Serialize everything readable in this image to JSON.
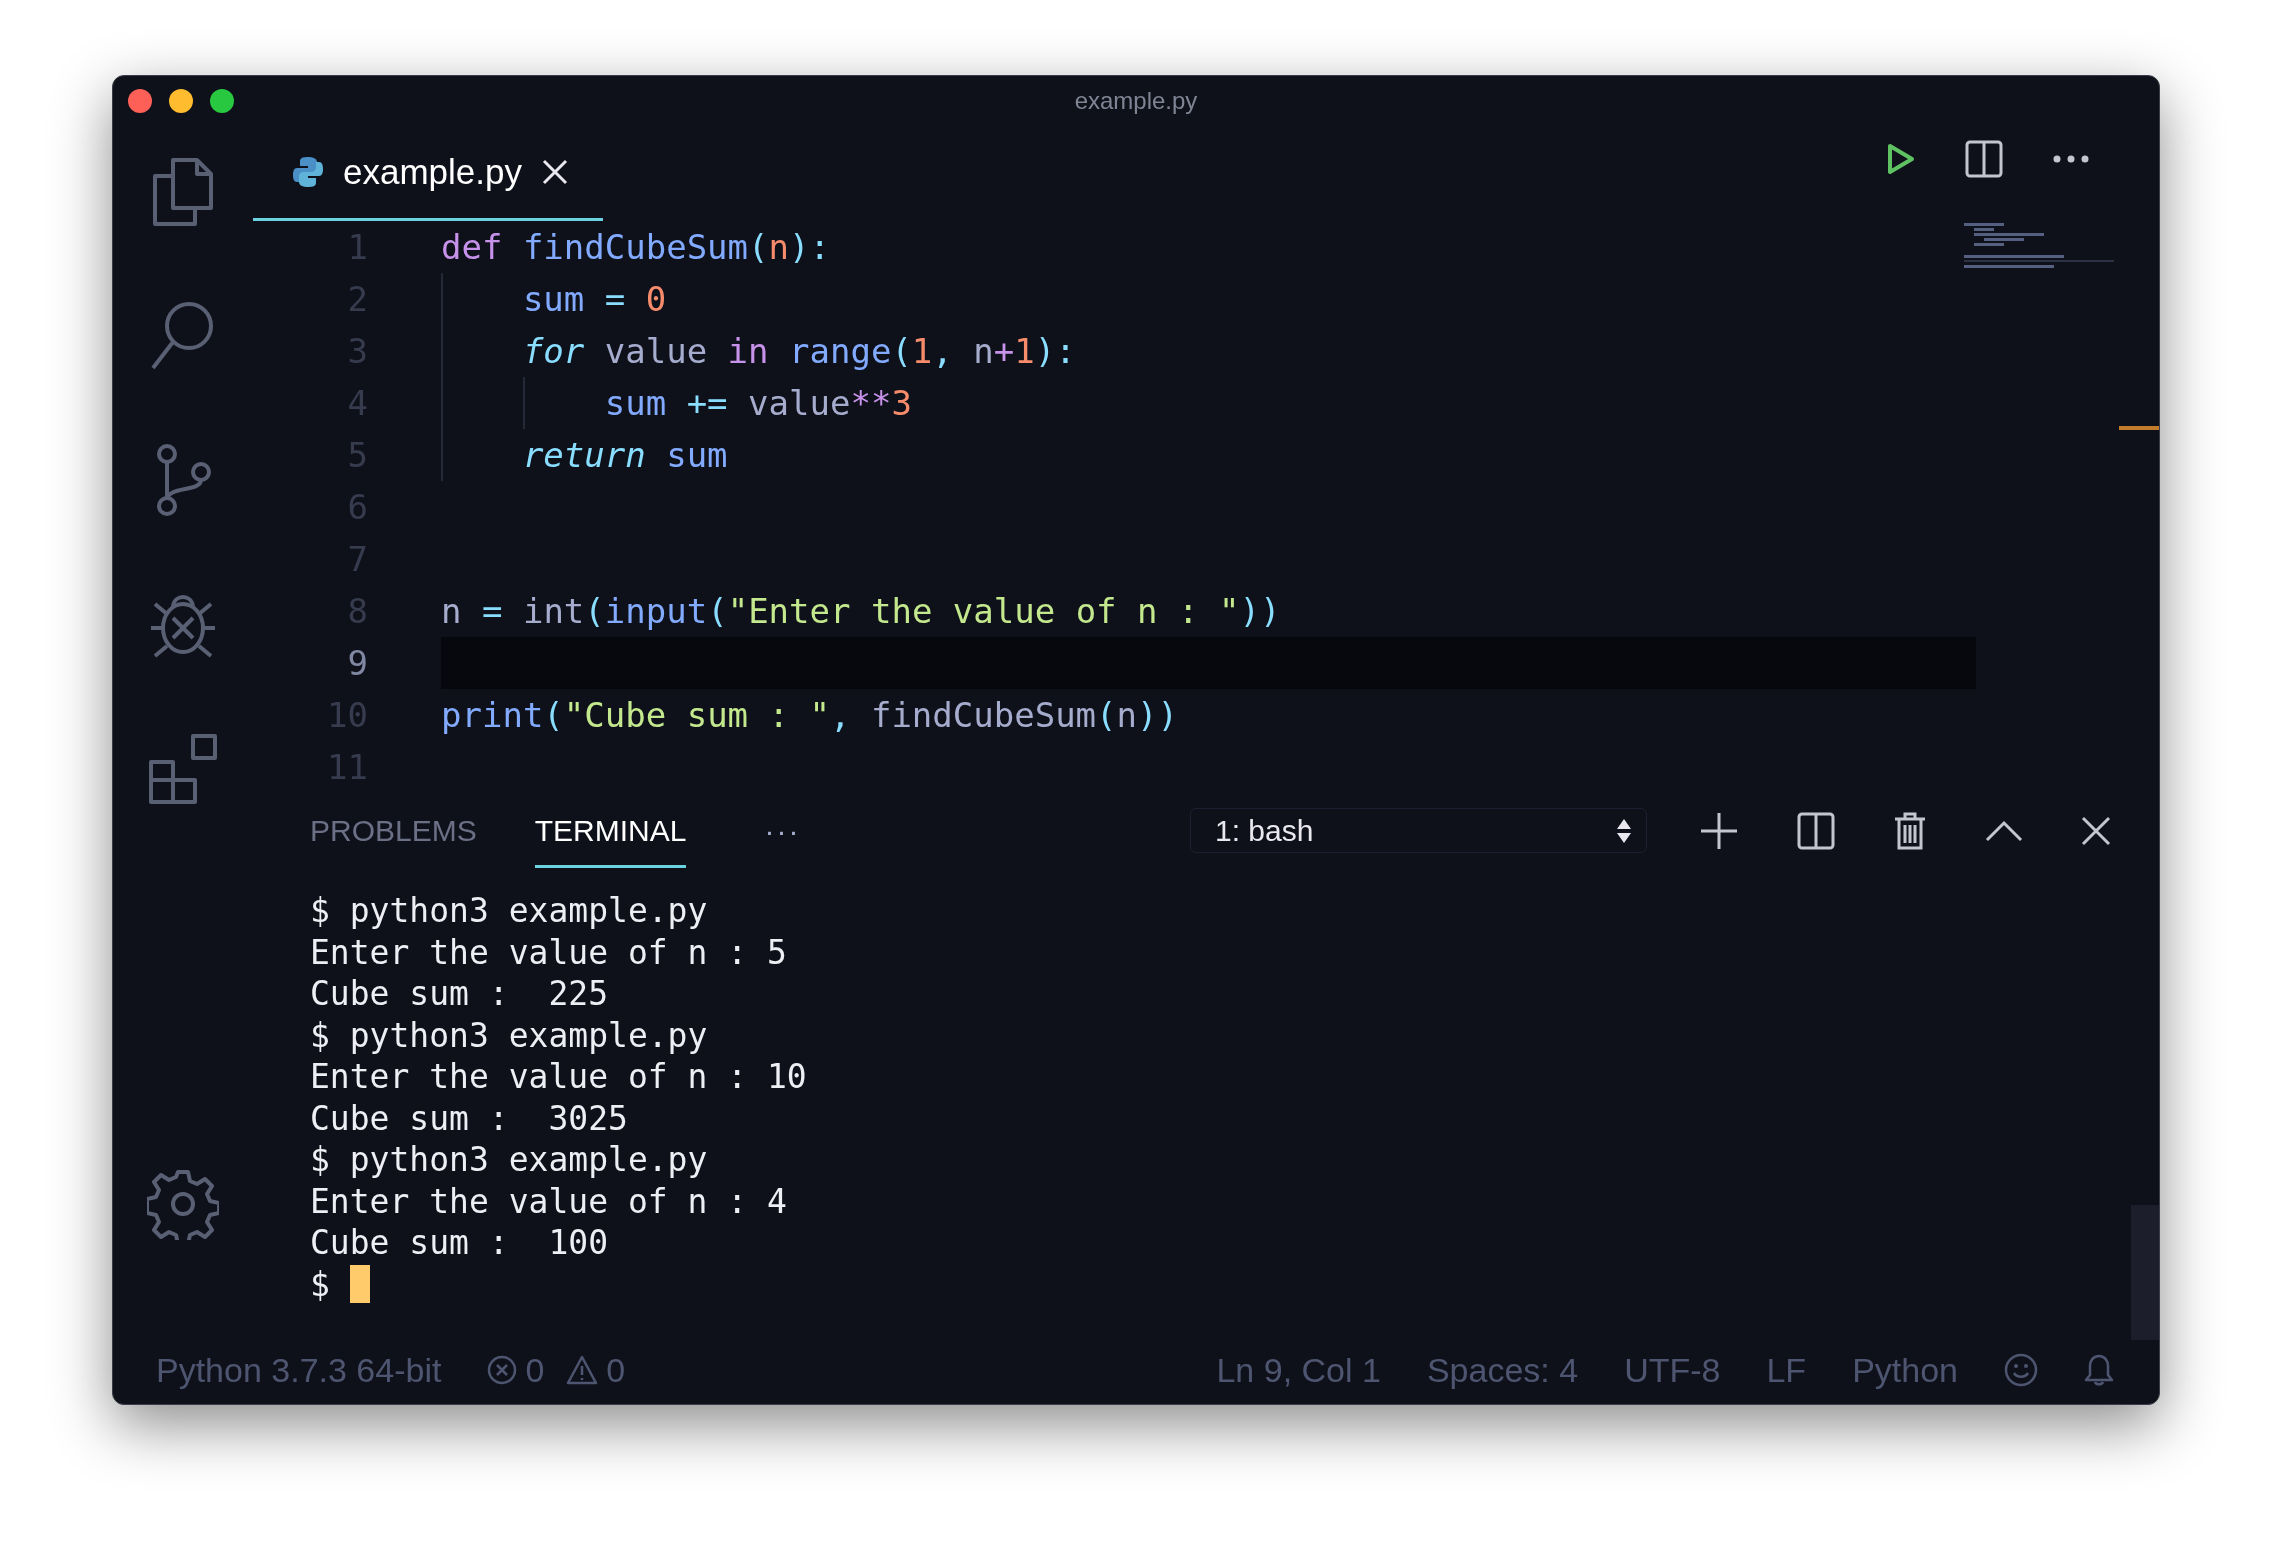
{
  "window": {
    "title": "example.py"
  },
  "tabs": [
    {
      "label": "example.py",
      "selected": true
    }
  ],
  "editor": {
    "lines": [
      {
        "number": "1",
        "current": false,
        "tokens": [
          {
            "kind": "keyword",
            "text": "def "
          },
          {
            "kind": "function",
            "text": "findCubeSum"
          },
          {
            "kind": "punct",
            "text": "("
          },
          {
            "kind": "param",
            "text": "n"
          },
          {
            "kind": "punct",
            "text": "):"
          }
        ]
      },
      {
        "number": "2",
        "current": false,
        "tokens": [
          {
            "kind": "variable",
            "text": "    sum "
          },
          {
            "kind": "punct",
            "text": "= "
          },
          {
            "kind": "number",
            "text": "0"
          }
        ]
      },
      {
        "number": "3",
        "current": false,
        "tokens": [
          {
            "kind": "control",
            "text": "    for "
          },
          {
            "kind": "plain",
            "text": "value "
          },
          {
            "kind": "keyword",
            "text": "in "
          },
          {
            "kind": "function",
            "text": "range"
          },
          {
            "kind": "punct",
            "text": "("
          },
          {
            "kind": "number",
            "text": "1"
          },
          {
            "kind": "punct",
            "text": ", "
          },
          {
            "kind": "plain",
            "text": "n"
          },
          {
            "kind": "keyword",
            "text": "+"
          },
          {
            "kind": "number",
            "text": "1"
          },
          {
            "kind": "punct",
            "text": "):"
          }
        ]
      },
      {
        "number": "4",
        "current": false,
        "tokens": [
          {
            "kind": "variable",
            "text": "        sum "
          },
          {
            "kind": "punct",
            "text": "+= "
          },
          {
            "kind": "plain",
            "text": "value"
          },
          {
            "kind": "keyword",
            "text": "**"
          },
          {
            "kind": "number",
            "text": "3"
          }
        ]
      },
      {
        "number": "5",
        "current": false,
        "tokens": [
          {
            "kind": "control",
            "text": "    return "
          },
          {
            "kind": "variable",
            "text": "sum"
          }
        ]
      },
      {
        "number": "6",
        "current": false
      },
      {
        "number": "7",
        "current": false
      },
      {
        "number": "8",
        "current": false,
        "tokens": [
          {
            "kind": "plain",
            "text": "n "
          },
          {
            "kind": "punct",
            "text": "= "
          },
          {
            "kind": "plain",
            "text": "int"
          },
          {
            "kind": "punct",
            "text": "("
          },
          {
            "kind": "function",
            "text": "input"
          },
          {
            "kind": "punct",
            "text": "("
          },
          {
            "kind": "string",
            "text": "\"Enter the value of n : \""
          },
          {
            "kind": "punct",
            "text": "))"
          }
        ]
      },
      {
        "number": "9",
        "current": true
      },
      {
        "number": "10",
        "current": false,
        "tokens": [
          {
            "kind": "function",
            "text": "print"
          },
          {
            "kind": "punct",
            "text": "("
          },
          {
            "kind": "string",
            "text": "\"Cube sum : \""
          },
          {
            "kind": "punct",
            "text": ", "
          },
          {
            "kind": "plain",
            "text": "findCubeSum"
          },
          {
            "kind": "punct",
            "text": "("
          },
          {
            "kind": "plain",
            "text": "n"
          },
          {
            "kind": "punct",
            "text": "))"
          }
        ]
      },
      {
        "number": "11",
        "current": false
      }
    ]
  },
  "panel": {
    "tabs": [
      {
        "label": "PROBLEMS",
        "selected": false
      },
      {
        "label": "TERMINAL",
        "selected": true
      }
    ],
    "more": "···",
    "terminal_select": "1: bash",
    "terminal_lines": [
      {
        "text": "$ python3 example.py",
        "cursor": false
      },
      {
        "text": "Enter the value of n : 5",
        "cursor": false
      },
      {
        "text": "Cube sum :  225",
        "cursor": false
      },
      {
        "text": "$ python3 example.py",
        "cursor": false
      },
      {
        "text": "Enter the value of n : 10",
        "cursor": false
      },
      {
        "text": "Cube sum :  3025",
        "cursor": false
      },
      {
        "text": "$ python3 example.py",
        "cursor": false
      },
      {
        "text": "Enter the value of n : 4",
        "cursor": false
      },
      {
        "text": "Cube sum :  100",
        "cursor": false
      },
      {
        "text": "$ ",
        "cursor": true
      }
    ]
  },
  "status_bar": {
    "interpreter": "Python 3.7.3 64-bit",
    "errors": "0",
    "warnings": "0",
    "right": [
      {
        "text": "Ln 9, Col 1"
      },
      {
        "text": "Spaces: 4"
      },
      {
        "text": "UTF-8"
      },
      {
        "text": "LF"
      },
      {
        "text": "Python"
      }
    ]
  }
}
